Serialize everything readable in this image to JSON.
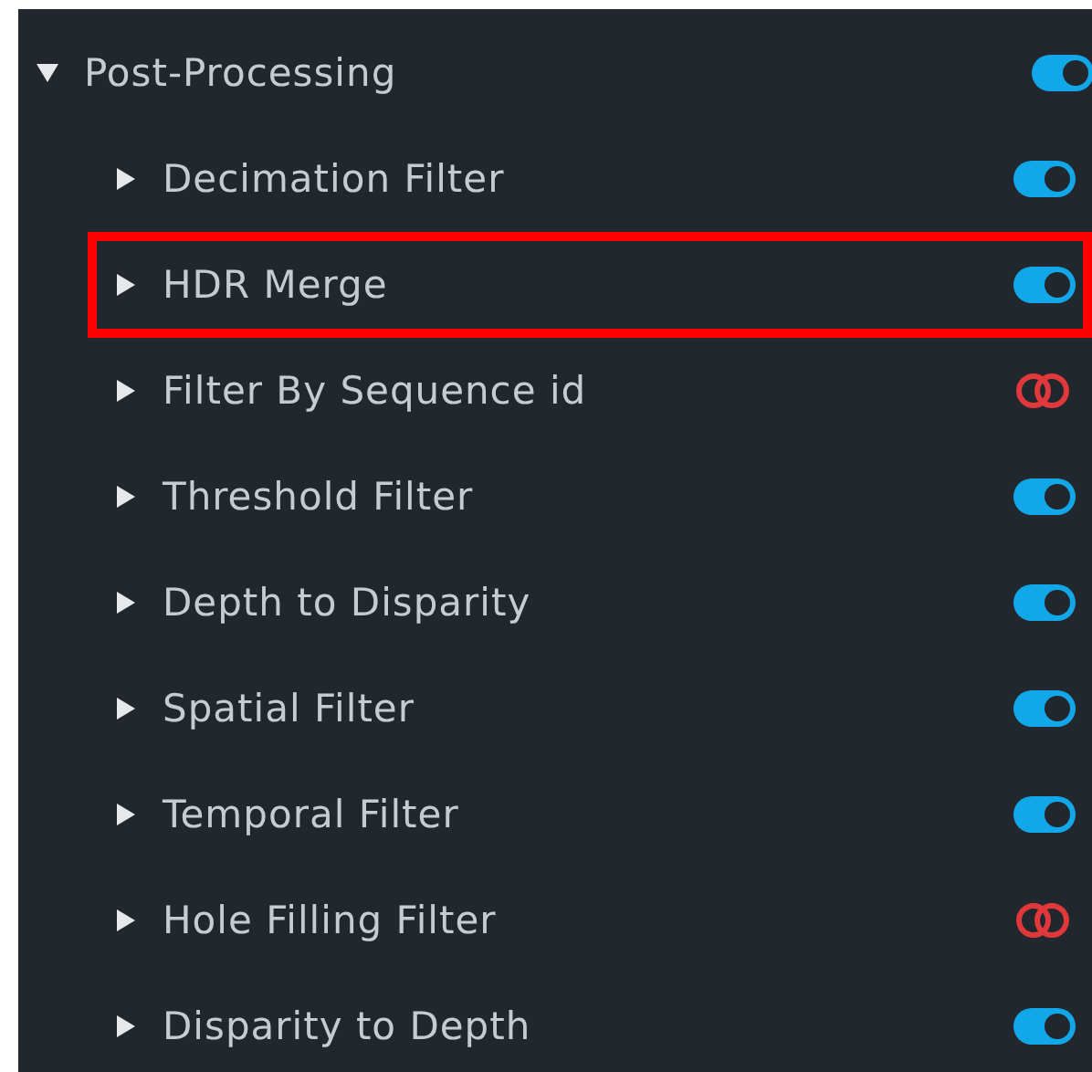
{
  "section": {
    "title": "Post-Processing",
    "expanded": true,
    "on": true,
    "children": [
      {
        "label": "Decimation Filter",
        "expanded": false,
        "on": true,
        "highlighted": false
      },
      {
        "label": "HDR Merge",
        "expanded": false,
        "on": true,
        "highlighted": true
      },
      {
        "label": "Filter By Sequence id",
        "expanded": false,
        "on": false,
        "highlighted": false
      },
      {
        "label": "Threshold Filter",
        "expanded": false,
        "on": true,
        "highlighted": false
      },
      {
        "label": "Depth to Disparity",
        "expanded": false,
        "on": true,
        "highlighted": false
      },
      {
        "label": "Spatial Filter",
        "expanded": false,
        "on": true,
        "highlighted": false
      },
      {
        "label": "Temporal Filter",
        "expanded": false,
        "on": true,
        "highlighted": false
      },
      {
        "label": "Hole Filling Filter",
        "expanded": false,
        "on": false,
        "highlighted": false
      },
      {
        "label": "Disparity to Depth",
        "expanded": false,
        "on": true,
        "highlighted": false
      }
    ]
  }
}
